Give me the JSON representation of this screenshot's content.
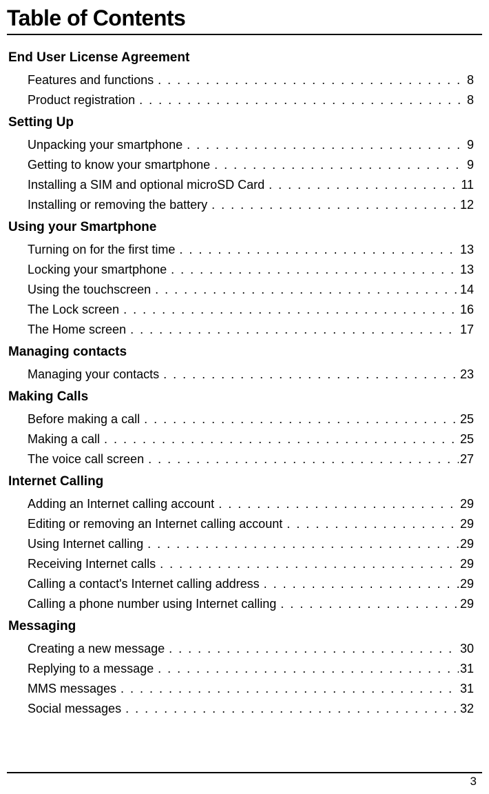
{
  "title": "Table of Contents",
  "page_number": "3",
  "sections": [
    {
      "heading": "End User License Agreement",
      "entries": [
        {
          "label": "Features and functions",
          "page": "8"
        },
        {
          "label": "Product registration",
          "page": "8"
        }
      ]
    },
    {
      "heading": "Setting Up",
      "entries": [
        {
          "label": "Unpacking your smartphone",
          "page": "9"
        },
        {
          "label": "Getting to know your smartphone",
          "page": "9"
        },
        {
          "label": "Installing a SIM and optional microSD Card",
          "page": "11"
        },
        {
          "label": "Installing or removing the battery",
          "page": "12"
        }
      ]
    },
    {
      "heading": " Using your Smartphone",
      "entries": [
        {
          "label": "Turning on for the first time",
          "page": "13"
        },
        {
          "label": "Locking your smartphone",
          "page": "13"
        },
        {
          "label": "Using the touchscreen",
          "page": "14"
        },
        {
          "label": "The Lock screen",
          "page": "16"
        },
        {
          "label": "The Home screen",
          "page": "17"
        }
      ]
    },
    {
      "heading": "Managing contacts",
      "entries": [
        {
          "label": "Managing your contacts",
          "page": "23"
        }
      ]
    },
    {
      "heading": "Making Calls",
      "entries": [
        {
          "label": "Before making a call",
          "page": "25"
        },
        {
          "label": "Making a call",
          "page": "25"
        },
        {
          "label": "The voice call screen",
          "page": "27"
        }
      ]
    },
    {
      "heading": "Internet Calling",
      "entries": [
        {
          "label": "Adding an Internet calling account",
          "page": "29"
        },
        {
          "label": "Editing or removing an Internet calling account",
          "page": "29"
        },
        {
          "label": "Using Internet calling",
          "page": "29"
        },
        {
          "label": "Receiving Internet calls",
          "page": "29"
        },
        {
          "label": "Calling a contact's Internet calling address",
          "page": "29"
        },
        {
          "label": "Calling a phone number using Internet calling",
          "page": "29"
        }
      ]
    },
    {
      "heading": "Messaging",
      "entries": [
        {
          "label": "Creating a new message",
          "page": "30"
        },
        {
          "label": "Replying to a message",
          "page": "31"
        },
        {
          "label": "MMS messages",
          "page": "31"
        },
        {
          "label": "Social messages",
          "page": "32"
        }
      ]
    }
  ]
}
